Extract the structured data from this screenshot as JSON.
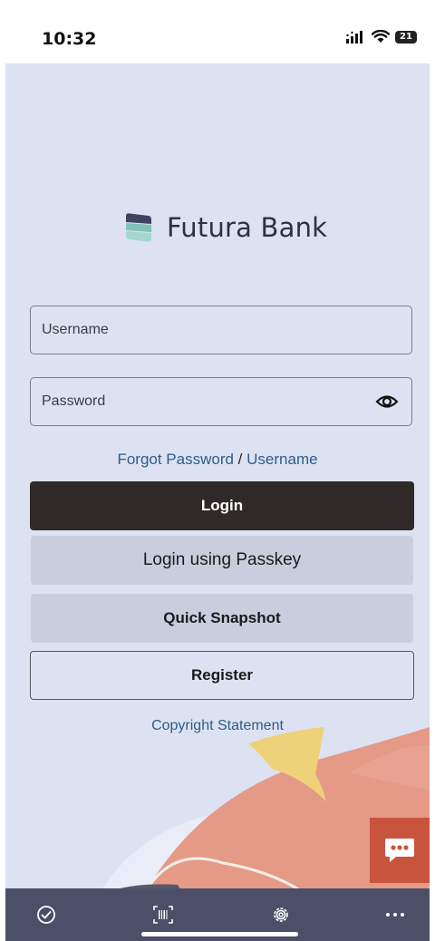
{
  "status_bar": {
    "time": "10:32",
    "battery": "21",
    "icons": [
      "signal-icon",
      "wifi-icon",
      "battery-icon"
    ]
  },
  "brand": {
    "name": "Futura Bank",
    "colors": {
      "logo_dark": "#3c4460",
      "logo_teal": "#7fc2ba",
      "logo_teal_light": "#a6d7cf"
    }
  },
  "login_form": {
    "username_placeholder": "Username",
    "password_placeholder": "Password",
    "forgot_password": "Forgot Password",
    "separator": "/",
    "forgot_username": "Username"
  },
  "buttons": {
    "login": "Login",
    "passkey": "Login using Passkey",
    "quick_snapshot": "Quick Snapshot",
    "register": "Register"
  },
  "footer": {
    "copyright": "Copyright Statement"
  },
  "bottom_nav": {
    "items": [
      "check-circle-icon",
      "barcode-scan-icon",
      "settings-gear-icon",
      "more-icon"
    ]
  },
  "colors": {
    "background": "#dde2f3",
    "primary_button": "#2f2a28",
    "secondary_button": "#c9cedf",
    "link": "#2d5d86",
    "chat_button": "#c9543d",
    "bottom_bar": "#4b5068"
  }
}
